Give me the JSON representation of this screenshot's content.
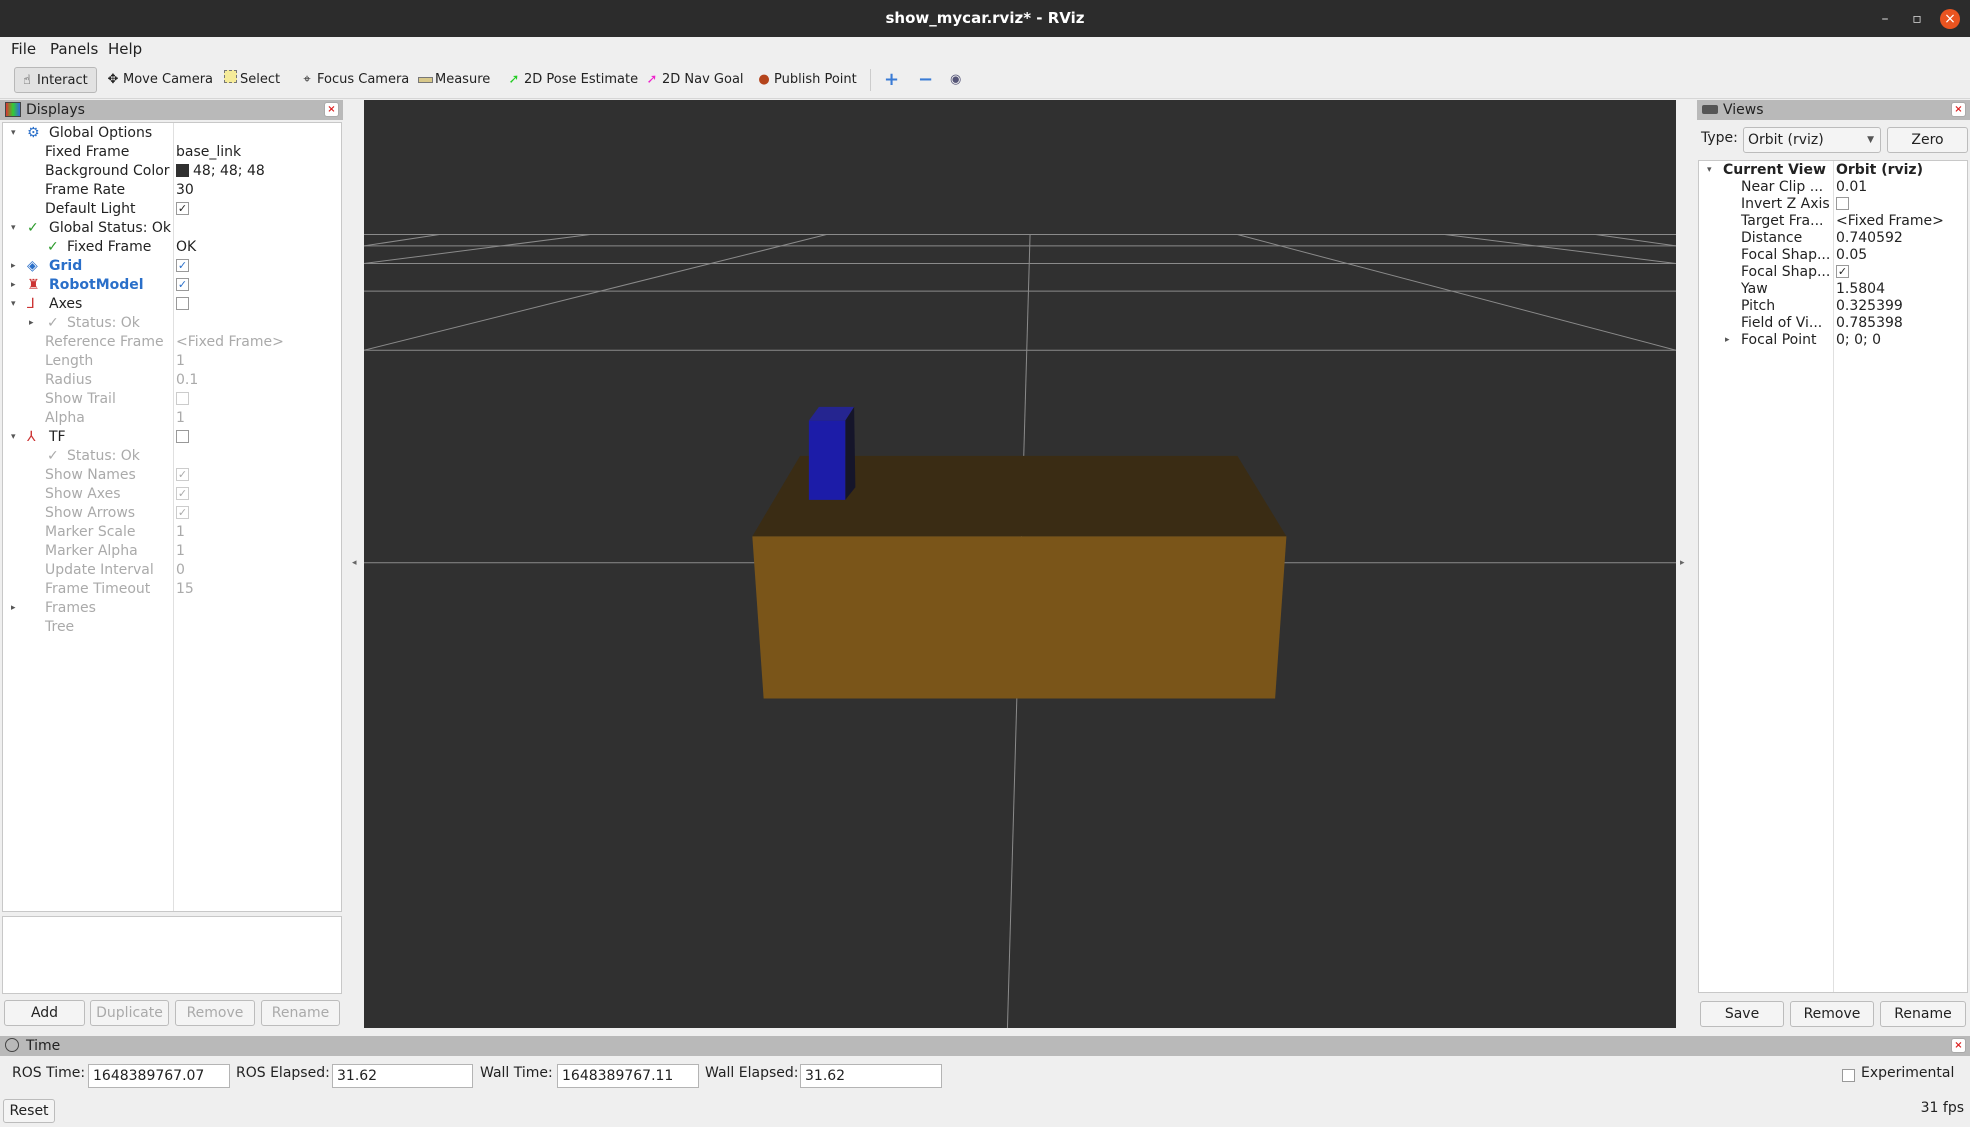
{
  "window": {
    "title": "show_mycar.rviz* - RViz"
  },
  "menu": [
    "File",
    "Panels",
    "Help"
  ],
  "toolbar": {
    "tools": [
      {
        "label": "Interact",
        "icon": "hand-icon",
        "active": true
      },
      {
        "label": "Move Camera",
        "icon": "move-camera-icon"
      },
      {
        "label": "Select",
        "icon": "select-icon"
      },
      {
        "label": "Focus Camera",
        "icon": "focus-camera-icon"
      },
      {
        "label": "Measure",
        "icon": "ruler-icon"
      },
      {
        "label": "2D Pose Estimate",
        "icon": "green-arrow-icon"
      },
      {
        "label": "2D Nav Goal",
        "icon": "magenta-arrow-icon"
      },
      {
        "label": "Publish Point",
        "icon": "map-pin-icon"
      }
    ]
  },
  "displays": {
    "title": "Displays",
    "rows": [
      {
        "k": "Global Options",
        "v": ""
      },
      {
        "k": "Fixed Frame",
        "v": "base_link"
      },
      {
        "k": "Background Color",
        "v": "48; 48; 48"
      },
      {
        "k": "Frame Rate",
        "v": "30"
      },
      {
        "k": "Default Light",
        "v": "✓"
      },
      {
        "k": "Global Status: Ok",
        "v": ""
      },
      {
        "k": "Fixed Frame",
        "v": "OK"
      },
      {
        "k": "Grid",
        "v": "✓"
      },
      {
        "k": "RobotModel",
        "v": "✓"
      },
      {
        "k": "Axes",
        "v": ""
      },
      {
        "k": "Status: Ok",
        "v": ""
      },
      {
        "k": "Reference Frame",
        "v": "<Fixed Frame>"
      },
      {
        "k": "Length",
        "v": "1"
      },
      {
        "k": "Radius",
        "v": "0.1"
      },
      {
        "k": "Show Trail",
        "v": ""
      },
      {
        "k": "Alpha",
        "v": "1"
      },
      {
        "k": "TF",
        "v": ""
      },
      {
        "k": "Status: Ok",
        "v": ""
      },
      {
        "k": "Show Names",
        "v": "✓"
      },
      {
        "k": "Show Axes",
        "v": "✓"
      },
      {
        "k": "Show Arrows",
        "v": "✓"
      },
      {
        "k": "Marker Scale",
        "v": "1"
      },
      {
        "k": "Marker Alpha",
        "v": "1"
      },
      {
        "k": "Update Interval",
        "v": "0"
      },
      {
        "k": "Frame Timeout",
        "v": "15"
      },
      {
        "k": "Frames",
        "v": ""
      },
      {
        "k": "Tree",
        "v": ""
      }
    ],
    "buttons": [
      "Add",
      "Duplicate",
      "Remove",
      "Rename"
    ]
  },
  "views": {
    "title": "Views",
    "type_label": "Type:",
    "type_value": "Orbit (rviz)",
    "zero": "Zero",
    "rows": [
      {
        "k": "Current View",
        "v": "Orbit (rviz)"
      },
      {
        "k": "Near Clip ...",
        "v": "0.01"
      },
      {
        "k": "Invert Z Axis",
        "v": ""
      },
      {
        "k": "Target Fra...",
        "v": "<Fixed Frame>"
      },
      {
        "k": "Distance",
        "v": "0.740592"
      },
      {
        "k": "Focal Shap...",
        "v": "0.05"
      },
      {
        "k": "Focal Shap...",
        "v": "✓"
      },
      {
        "k": "Yaw",
        "v": "1.5804"
      },
      {
        "k": "Pitch",
        "v": "0.325399"
      },
      {
        "k": "Field of Vi...",
        "v": "0.785398"
      },
      {
        "k": "Focal Point",
        "v": "0; 0; 0"
      }
    ],
    "buttons": [
      "Save",
      "Remove",
      "Rename"
    ]
  },
  "time": {
    "title": "Time",
    "ros_time_label": "ROS Time:",
    "ros_time": "1648389767.07",
    "ros_elapsed_label": "ROS Elapsed:",
    "ros_elapsed": "31.62",
    "wall_time_label": "Wall Time:",
    "wall_time": "1648389767.11",
    "wall_elapsed_label": "Wall Elapsed:",
    "wall_elapsed": "31.62",
    "experimental": "Experimental",
    "reset": "Reset",
    "fps": "31 fps"
  },
  "colors": {
    "background": "#303030",
    "body": "#7a5519",
    "wheel": "#1a1aa0"
  }
}
